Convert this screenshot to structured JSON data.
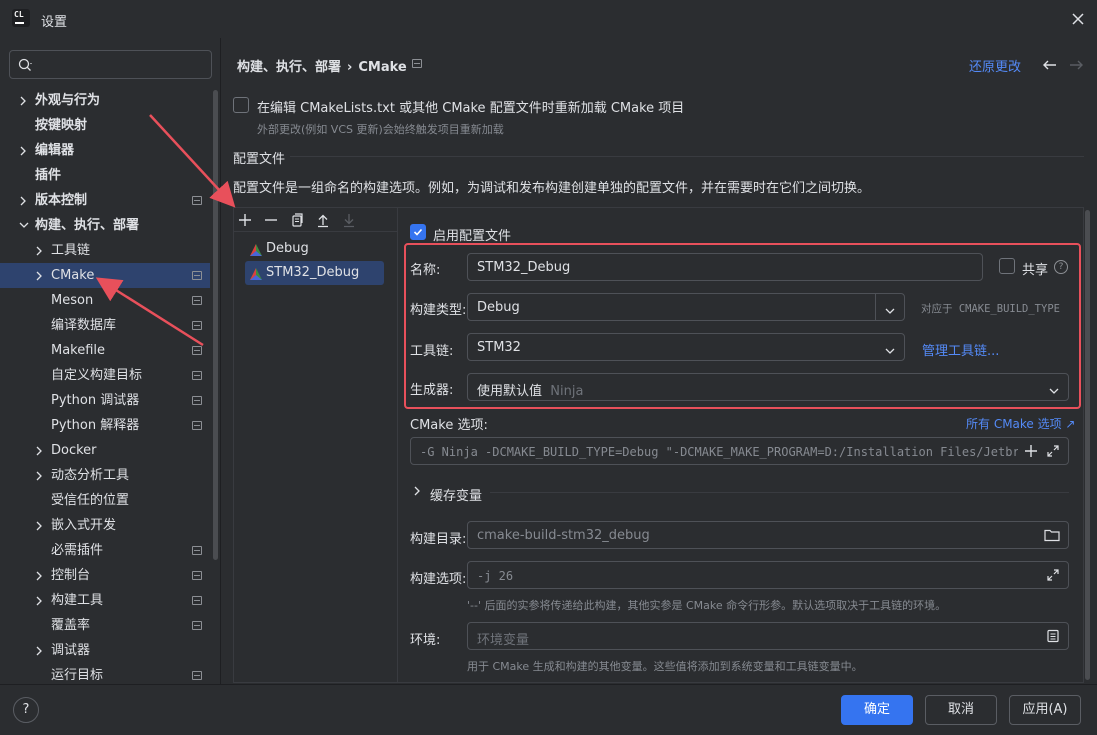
{
  "window": {
    "title": "设置",
    "app_icon_text": "CL"
  },
  "search": {
    "placeholder": ""
  },
  "sidebar": {
    "items": [
      {
        "label": "外观与行为",
        "expandable": true,
        "bold": true
      },
      {
        "label": "按键映射",
        "expandable": false,
        "bold": true
      },
      {
        "label": "编辑器",
        "expandable": true,
        "bold": true
      },
      {
        "label": "插件",
        "expandable": false,
        "bold": true
      },
      {
        "label": "版本控制",
        "expandable": true,
        "bold": true,
        "project_icon": true
      },
      {
        "label": "构建、执行、部署",
        "expandable": true,
        "expanded": true,
        "bold": true
      },
      {
        "label": "工具链",
        "expandable": true,
        "indent": 1
      },
      {
        "label": "CMake",
        "expandable": true,
        "indent": 1,
        "selected": true,
        "project_icon": true
      },
      {
        "label": "Meson",
        "indent": 1,
        "project_icon": true
      },
      {
        "label": "编译数据库",
        "indent": 1,
        "project_icon": true
      },
      {
        "label": "Makefile",
        "indent": 1,
        "project_icon": true
      },
      {
        "label": "自定义构建目标",
        "indent": 1,
        "project_icon": true
      },
      {
        "label": "Python 调试器",
        "indent": 1,
        "project_icon": true
      },
      {
        "label": "Python 解释器",
        "indent": 1,
        "project_icon": true
      },
      {
        "label": "Docker",
        "expandable": true,
        "indent": 1
      },
      {
        "label": "动态分析工具",
        "expandable": true,
        "indent": 1
      },
      {
        "label": "受信任的位置",
        "indent": 1
      },
      {
        "label": "嵌入式开发",
        "expandable": true,
        "indent": 1
      },
      {
        "label": "必需插件",
        "indent": 1,
        "project_icon": true
      },
      {
        "label": "控制台",
        "expandable": true,
        "indent": 1,
        "project_icon": true
      },
      {
        "label": "构建工具",
        "expandable": true,
        "indent": 1,
        "project_icon": true
      },
      {
        "label": "覆盖率",
        "indent": 1,
        "project_icon": true
      },
      {
        "label": "调试器",
        "expandable": true,
        "indent": 1
      },
      {
        "label": "运行目标",
        "indent": 1,
        "project_icon": true
      }
    ]
  },
  "header": {
    "breadcrumb_parent": "构建、执行、部署",
    "breadcrumb_sep": "›",
    "breadcrumb_current": "CMake",
    "reset_label": "还原更改"
  },
  "reload": {
    "checked": false,
    "label": "在编辑 CMakeLists.txt 或其他 CMake 配置文件时重新加载 CMake 项目",
    "hint": "外部更改(例如 VCS 更新)会始终触发项目重新加载"
  },
  "profiles": {
    "section_title": "配置文件",
    "description": "配置文件是一组命名的构建选项。例如，为调试和发布构建创建单独的配置文件，并在需要时在它们之间切换。",
    "list": [
      {
        "name": "Debug",
        "selected": false
      },
      {
        "name": "STM32_Debug",
        "selected": true
      }
    ]
  },
  "form": {
    "enable_label": "启用配置文件",
    "enable_checked": true,
    "name_label": "名称:",
    "name_value": "STM32_Debug",
    "share_label": "共享",
    "share_checked": false,
    "help_glyph": "?",
    "build_type_label": "构建类型:",
    "build_type_value": "Debug",
    "build_type_hint": "对应于 CMAKE_BUILD_TYPE",
    "toolchain_label": "工具链:",
    "toolchain_value": "STM32",
    "manage_toolchains": "管理工具链...",
    "generator_label": "生成器:",
    "generator_value": "使用默认值",
    "generator_default": "Ninja",
    "cmake_options_label": "CMake 选项:",
    "all_cmake_options": "所有 CMake 选项 ↗",
    "cmake_options_value": "-G Ninja -DCMAKE_BUILD_TYPE=Debug \"-DCMAKE_MAKE_PROGRAM=D:/Installation Files/Jetbrain",
    "cache_vars_label": "缓存变量",
    "build_dir_label": "构建目录:",
    "build_dir_value": "cmake-build-stm32_debug",
    "build_opts_label": "构建选项:",
    "build_opts_value": "-j 26",
    "build_opts_hint": "'--' 后面的实参将传递给此构建，其他实参是 CMake 命令行形参。默认选项取决于工具链的环境。",
    "env_label": "环境:",
    "env_placeholder": "环境变量",
    "env_hint": "用于 CMake 生成和构建的其他变量。这些值将添加到系统变量和工具链变量中。"
  },
  "footer": {
    "help_glyph": "?",
    "ok_label": "确定",
    "cancel_label": "取消",
    "apply_label": "应用(A)"
  },
  "colors": {
    "accent": "#3574f0",
    "link": "#548af7",
    "annotation": "#e8505b",
    "selection": "#2e436e",
    "background": "#2b2d30"
  }
}
